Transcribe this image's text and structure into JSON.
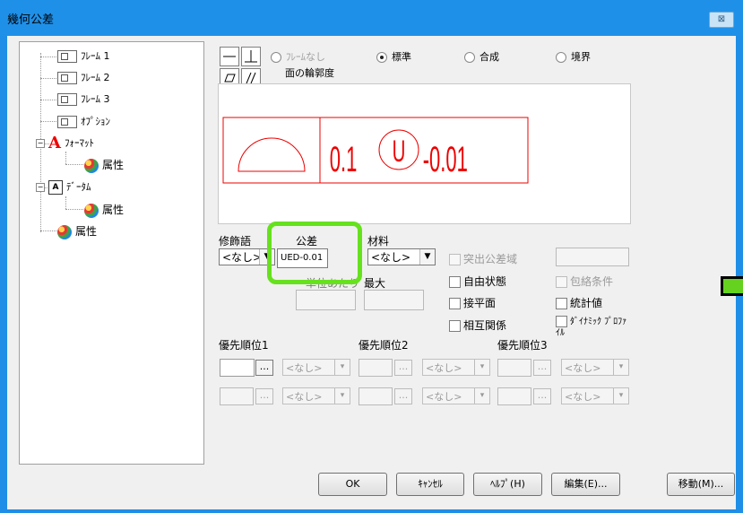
{
  "window": {
    "title": "幾何公差",
    "close_label": "⊠"
  },
  "tree": {
    "items": [
      {
        "label": "ﾌﾚｰﾑ 1"
      },
      {
        "label": "ﾌﾚｰﾑ 2"
      },
      {
        "label": "ﾌﾚｰﾑ 3"
      },
      {
        "label": "ｵﾌﾟｼｮﾝ"
      },
      {
        "label": "ﾌｫｰﾏｯﾄ"
      },
      {
        "label": "属性"
      },
      {
        "label": "ﾃﾞｰﾀﾑ"
      },
      {
        "label": "属性"
      },
      {
        "label": "属性"
      }
    ]
  },
  "frame_options": {
    "none": "ﾌﾚｰﾑなし",
    "standard": "標準",
    "composite": "合成",
    "boundary": "境界",
    "selected": "標準"
  },
  "symbol_caption": "面の輪郭度",
  "preview": {
    "tolerance": "0.1",
    "modifier_symbol": "U",
    "offset": "-0.01"
  },
  "modifier": {
    "label": "修飾語",
    "value": "<なし>"
  },
  "tolerance": {
    "label": "公差",
    "value": "UED-0.01",
    "per_unit_label": "単位あたり",
    "max_label": "最大"
  },
  "material": {
    "label": "材料",
    "value": "<なし>"
  },
  "checkboxes": {
    "projected_zone": "突出公差域",
    "free_state": "自由状態",
    "envelope": "包絡条件",
    "tangent_plane": "接平面",
    "statistical": "統計値",
    "interrelation": "相互関係",
    "dynamic_profile": "ﾀﾞｲﾅﾐｯｸ ﾌﾟﾛﾌｧｲﾙ"
  },
  "datum": {
    "primary": "優先順位1",
    "secondary": "優先順位2",
    "tertiary": "優先順位3",
    "none_value": "<なし>",
    "dots": "..."
  },
  "buttons": {
    "ok": "OK",
    "cancel": "ｷｬﾝｾﾙ",
    "help": "ﾍﾙﾌﾟ(H)",
    "edit": "編集(E)...",
    "move": "移動(M)..."
  }
}
